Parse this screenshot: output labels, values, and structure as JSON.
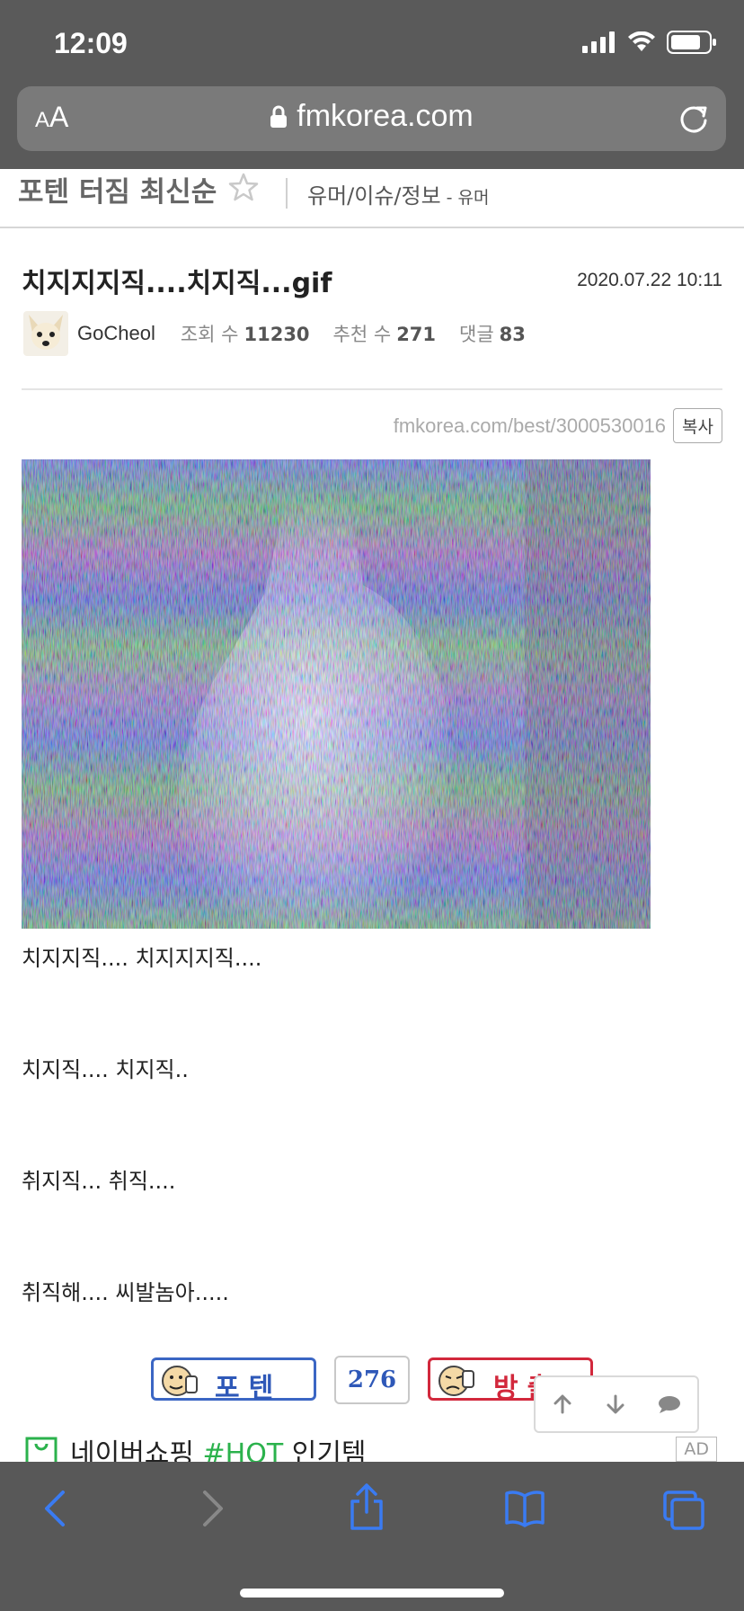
{
  "status_bar": {
    "time": "12:09"
  },
  "browser": {
    "text_size_label_small": "A",
    "text_size_label_big": "A",
    "url": "fmkorea.com"
  },
  "board": {
    "title": "포텐 터짐 최신순",
    "category": "유머/이슈/정보",
    "subcategory": "- 유머"
  },
  "post": {
    "title": "치지지지직....치지직...gif",
    "date": "2020.07.22 10:11",
    "author": "GoCheol",
    "stats": [
      {
        "label": "조회 수",
        "value": "11230"
      },
      {
        "label": "추천 수",
        "value": "271"
      },
      {
        "label": "댓글",
        "value": "83"
      }
    ],
    "permalink": "fmkorea.com/best/3000530016",
    "copy_label": "복사",
    "body_lines": [
      "치지지직.... 치지지지직....",
      "치지직.... 치지직..",
      "취지직... 취직....",
      "취직해.... 씨발놈아....."
    ]
  },
  "vote": {
    "up_label": "포텐",
    "count": "276",
    "down_label": "방출"
  },
  "ad": {
    "text_before": "네이버쇼핑 ",
    "text_hot": "#HOT",
    "text_after": " 인기템",
    "badge": "AD"
  },
  "colors": {
    "chrome_bg": "#5a5a5a",
    "url_bar_bg": "#7a7a7a",
    "vote_up": "#2e58b8",
    "vote_down": "#d2283c",
    "safari_blue": "#3a7bf2"
  }
}
